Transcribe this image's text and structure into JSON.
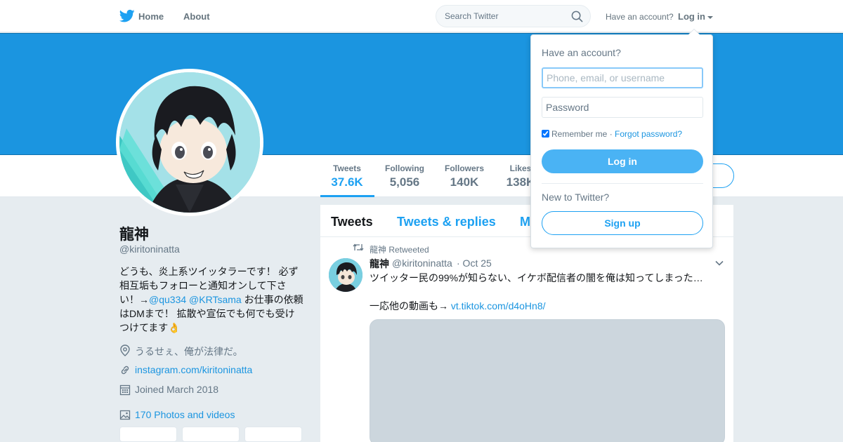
{
  "topbar": {
    "logo_icon": "twitter-bird-icon",
    "nav_home": "Home",
    "nav_about": "About",
    "search_placeholder": "Search Twitter",
    "have_account": "Have an account?",
    "login_label": "Log in"
  },
  "profile": {
    "name": "龍神",
    "handle": "@kiritoninatta",
    "bio_part1": "どうも、炎上系ツイッタラーです！ 必ず相互垢もフォローと通知オンして下さい！→",
    "bio_link1": "@qu334",
    "bio_link2": "@KRTsama",
    "bio_part2": " お仕事の依頼はDMまで！ 拡散や宣伝でも何でも受けつけてます👌",
    "location": "うるせぇ、俺が法律だ。",
    "url": "instagram.com/kiritoninatta",
    "joined": "Joined March 2018",
    "photos": "170 Photos and videos"
  },
  "stats": [
    {
      "label": "Tweets",
      "value": "37.6K"
    },
    {
      "label": "Following",
      "value": "5,056"
    },
    {
      "label": "Followers",
      "value": "140K"
    },
    {
      "label": "Likes",
      "value": "138K"
    }
  ],
  "timeline": {
    "tabs": [
      "Tweets",
      "Tweets & replies",
      "M"
    ],
    "retweet_label": "龍神 Retweeted",
    "tweet": {
      "name": "龍神",
      "handle": "@kiritoninatta",
      "date": "· Oct 25",
      "text": "ツイッター民の99%が知らない、イケボ配信者の闇を俺は知ってしまった…",
      "text2_prefix": "一応他の動画も→ ",
      "link": "vt.tiktok.com/d4oHn8/"
    }
  },
  "login_dropdown": {
    "title": "Have an account?",
    "username_placeholder": "Phone, email, or username",
    "password_placeholder": "Password",
    "remember": "Remember me",
    "separator": " · ",
    "forgot": "Forgot password?",
    "login_button": "Log in",
    "new_to": "New to Twitter?",
    "signup_button": "Sign up"
  },
  "colors": {
    "brand_blue": "#1da1f2",
    "banner": "#1b95e0",
    "page_bg": "#e6ecf0"
  }
}
